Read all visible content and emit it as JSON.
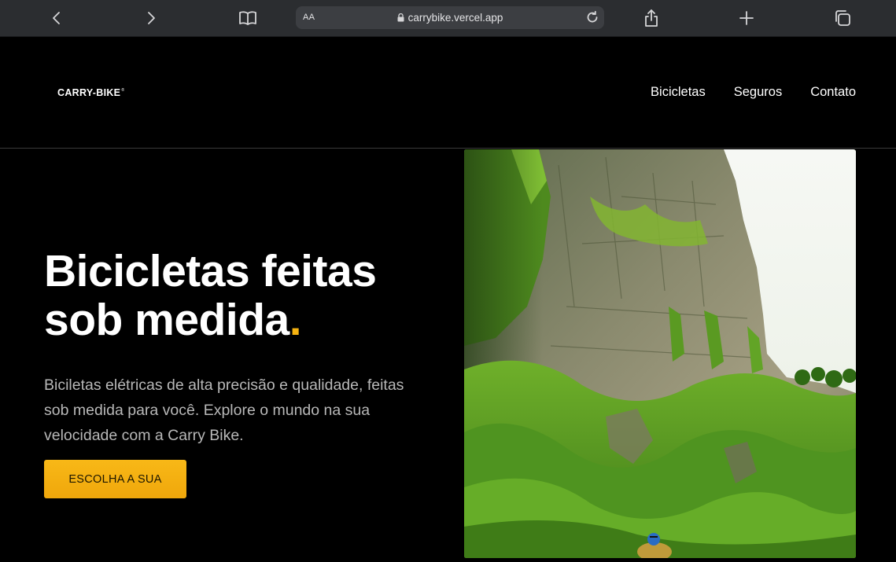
{
  "browser": {
    "url_aa": "AA",
    "url": "carrybike.vercel.app",
    "icons": [
      "back-icon",
      "forward-icon",
      "bookmarks-icon",
      "lock-icon",
      "reload-icon",
      "share-icon",
      "new-tab-icon",
      "tabs-icon"
    ]
  },
  "header": {
    "logo": "CARRY-BIKE",
    "logo_mark": "®",
    "nav": [
      "Bicicletas",
      "Seguros",
      "Contato"
    ]
  },
  "hero": {
    "title_line1": "Bicicletas feitas",
    "title_line2": "sob medida",
    "title_dot": ".",
    "description": "Biciletas elétricas de alta precisão e qualidade, feitas sob medida para você. Explore o mundo na sua velocidade com a Carry Bike.",
    "cta_label": "ESCOLHA A SUA"
  },
  "colors": {
    "accent": "#f6b311",
    "background": "#000000",
    "toolbar": "#2b2d30"
  }
}
